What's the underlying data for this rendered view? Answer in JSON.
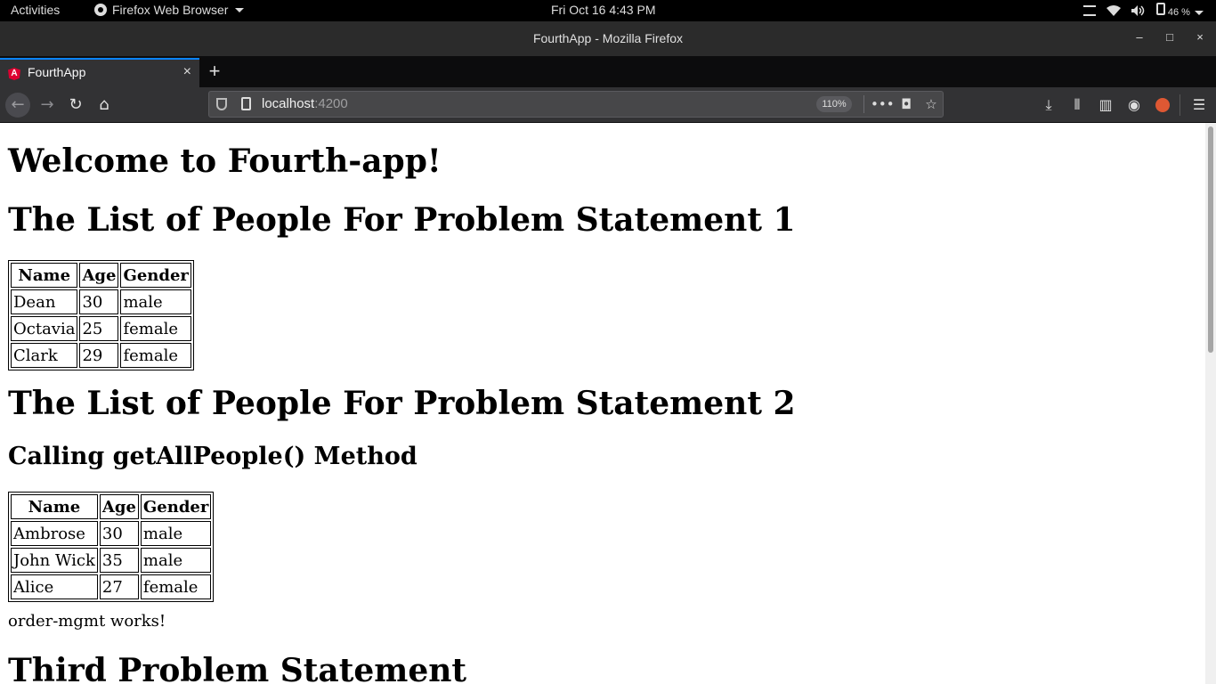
{
  "system_bar": {
    "activities": "Activities",
    "app_name": "Firefox Web Browser",
    "clock": "Fri Oct 16   4:43 PM",
    "battery": "46 %"
  },
  "window": {
    "title": "FourthApp - Mozilla Firefox",
    "minimize": "–",
    "maximize": "□",
    "close": "×"
  },
  "tabs": [
    {
      "label": "FourthApp",
      "favicon_letter": "A",
      "close": "×"
    }
  ],
  "newtab": "+",
  "navbar": {
    "url_host": "localhost",
    "url_port": ":4200",
    "zoom": "110%",
    "page_actions": "•••"
  },
  "page": {
    "heading_welcome": "Welcome to Fourth-app!",
    "heading_ps1": "The List of People For Problem Statement 1",
    "heading_ps2": "The List of People For Problem Statement 2",
    "subheading_call": "Calling getAllPeople() Method",
    "order_mgmt_text": "order-mgmt works!",
    "heading_ps3": "Third Problem Statement",
    "columns": [
      "Name",
      "Age",
      "Gender"
    ],
    "table1": [
      [
        "Dean",
        "30",
        "male"
      ],
      [
        "Octavia",
        "25",
        "female"
      ],
      [
        "Clark",
        "29",
        "female"
      ]
    ],
    "table2": [
      [
        "Ambrose",
        "30",
        "male"
      ],
      [
        "John Wick",
        "35",
        "male"
      ],
      [
        "Alice",
        "27",
        "female"
      ]
    ]
  }
}
